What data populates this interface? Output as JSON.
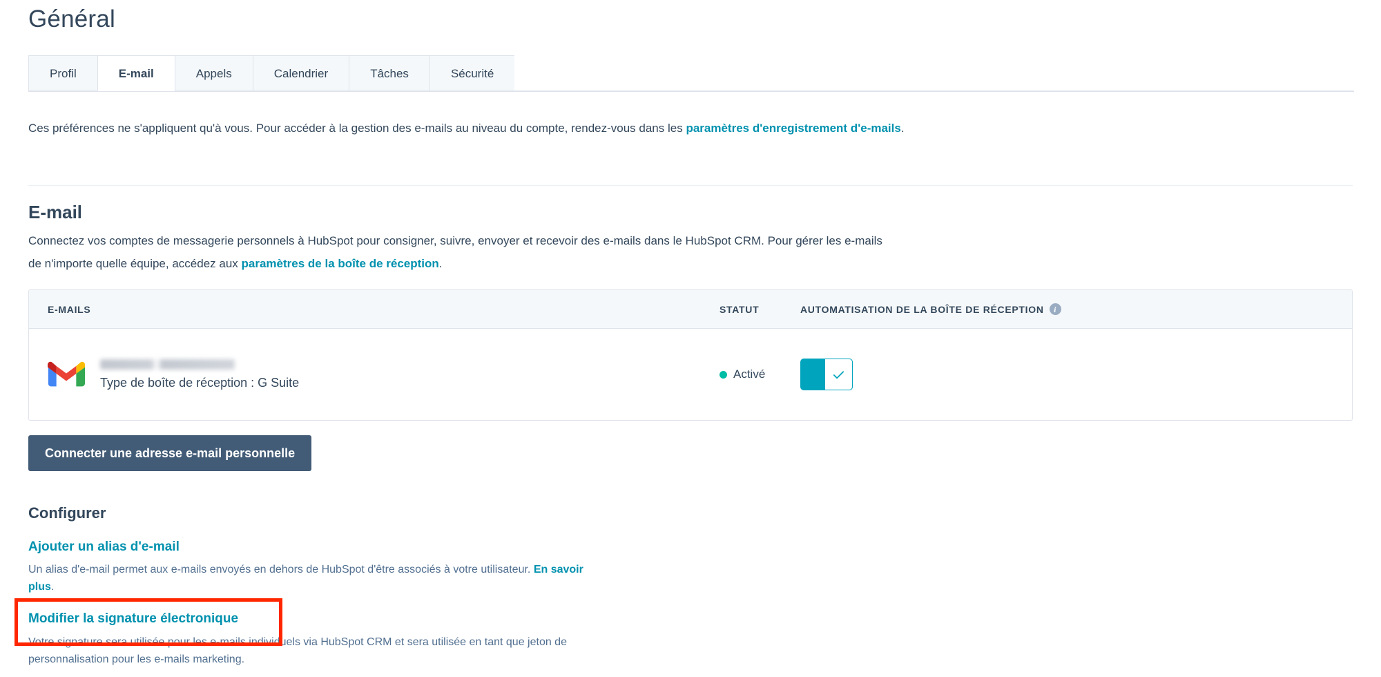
{
  "header": {
    "title": "Général"
  },
  "tabs": [
    {
      "label": "Profil",
      "active": false
    },
    {
      "label": "E-mail",
      "active": true
    },
    {
      "label": "Appels",
      "active": false
    },
    {
      "label": "Calendrier",
      "active": false
    },
    {
      "label": "Tâches",
      "active": false
    },
    {
      "label": "Sécurité",
      "active": false
    }
  ],
  "intro": {
    "text_before": "Ces préférences ne s'appliquent qu'à vous. Pour accéder à la gestion des e-mails au niveau du compte, rendez-vous dans les ",
    "link": "paramètres d'enregistrement d'e-mails",
    "text_after": "."
  },
  "email_section": {
    "title": "E-mail",
    "desc_before": "Connectez vos comptes de messagerie personnels à HubSpot pour consigner, suivre, envoyer et recevoir des e-mails dans le HubSpot CRM. Pour gérer les e-mails de n'importe quelle équipe, accédez aux ",
    "desc_link": "paramètres de la boîte de réception",
    "desc_after": ".",
    "table": {
      "columns": {
        "emails": "E-MAILS",
        "statut": "STATUT",
        "automatisation": "AUTOMATISATION DE LA BOÎTE DE RÉCEPTION",
        "info_icon": "info-icon"
      },
      "rows": [
        {
          "provider_icon": "gmail-icon",
          "address": "",
          "address_redacted": true,
          "inbox_type": "Type de boîte de réception : G Suite",
          "status": "Activé",
          "status_color": "#00bda5",
          "automation_enabled": true
        }
      ]
    },
    "connect_button": "Connecter une adresse e-mail personnelle"
  },
  "configure": {
    "title": "Configurer",
    "items": [
      {
        "link": "Ajouter un alias d'e-mail",
        "desc_before": "Un alias d'e-mail permet aux e-mails envoyés en dehors de HubSpot d'être associés à votre utilisateur. ",
        "desc_link": "En savoir plus",
        "desc_after": "."
      },
      {
        "link": "Modifier la signature électronique",
        "desc_before": "Votre signature sera utilisée pour les e-mails individuels via HubSpot CRM et sera utilisée en tant que jeton de personnalisation pour les e-mails marketing.",
        "desc_link": "",
        "desc_after": ""
      }
    ]
  },
  "annotation": {
    "name": "highlight-box",
    "color": "#ff2600"
  },
  "colors": {
    "link": "#0091ae",
    "text": "#33475b",
    "muted": "#516f90",
    "primary_button": "#425b76",
    "toggle_on": "#00a4bd",
    "status_on": "#00bda5",
    "border": "#dfe3eb",
    "header_bg": "#f5f8fa"
  }
}
